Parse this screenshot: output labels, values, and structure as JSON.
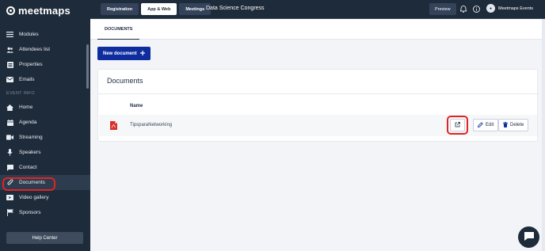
{
  "brand": {
    "name": "meetmaps"
  },
  "sidebar": {
    "top_items": [
      {
        "label": "Modules",
        "icon": "menu-icon"
      },
      {
        "label": "Attendees list",
        "icon": "users-icon"
      },
      {
        "label": "Properties",
        "icon": "list-icon"
      },
      {
        "label": "Emails",
        "icon": "mail-icon"
      }
    ],
    "section_label": "EVENT INFO",
    "event_items": [
      {
        "label": "Home",
        "icon": "home-icon"
      },
      {
        "label": "Agenda",
        "icon": "calendar-icon"
      },
      {
        "label": "Streaming",
        "icon": "video-icon"
      },
      {
        "label": "Speakers",
        "icon": "microphone-icon"
      },
      {
        "label": "Contact",
        "icon": "chat-icon"
      },
      {
        "label": "Documents",
        "icon": "paperclip-icon",
        "active": true
      },
      {
        "label": "Video gallery",
        "icon": "film-icon"
      },
      {
        "label": "Sponsors",
        "icon": "flag-icon"
      }
    ],
    "help_label": "Help Center"
  },
  "topbar": {
    "tabs": [
      {
        "label": "Registration",
        "active": false
      },
      {
        "label": "App & Web",
        "active": true
      },
      {
        "label": "Meetings",
        "active": false
      }
    ],
    "event_title": "Data Science Congress",
    "preview_label": "Preview",
    "user_name": "Meetmaps Events"
  },
  "content": {
    "subtab_label": "DOCUMENTS",
    "new_button_label": "New document",
    "card_title": "Documents",
    "column_header": "Name",
    "rows": [
      {
        "name": "TipsparaNetworking",
        "edit_label": "Edit",
        "delete_label": "Delete"
      }
    ]
  },
  "colors": {
    "sidebar": "#1e2b3a",
    "primary": "#0f2d9e",
    "highlight": "#e02424",
    "pdf": "#d93025"
  }
}
